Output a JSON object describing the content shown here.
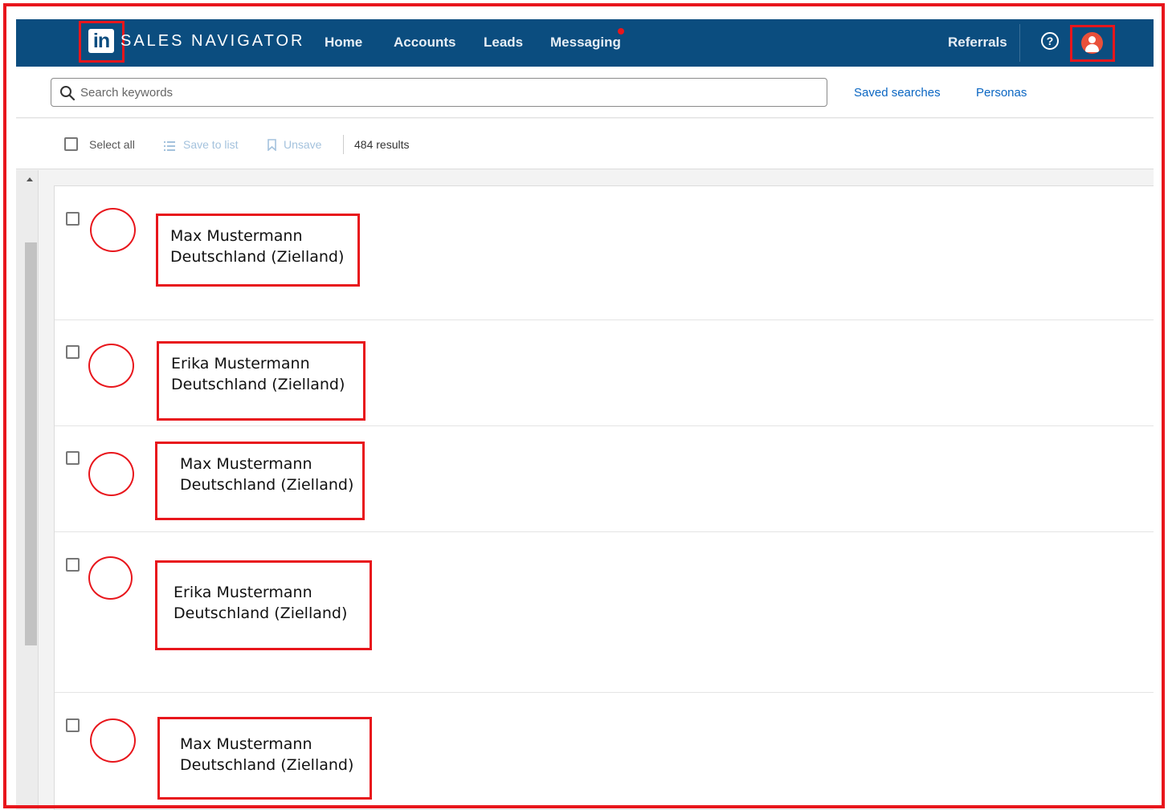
{
  "nav": {
    "logo_text": "in",
    "brand": "SALES NAVIGATOR",
    "links": [
      "Home",
      "Accounts",
      "Leads",
      "Messaging"
    ],
    "referrals": "Referrals",
    "help_symbol": "?"
  },
  "search": {
    "placeholder": "Search keywords",
    "saved_searches": "Saved searches",
    "personas": "Personas"
  },
  "toolbar": {
    "select_all": "Select all",
    "save_to_list": "Save to list",
    "unsave": "Unsave",
    "results_count": "484 results"
  },
  "leads": [
    {
      "name": "Max Mustermann",
      "location": "Deutschland (Zielland)"
    },
    {
      "name": "Erika Mustermann",
      "location": "Deutschland (Zielland)"
    },
    {
      "name": "Max Mustermann",
      "location": "Deutschland (Zielland)"
    },
    {
      "name": "Erika Mustermann",
      "location": "Deutschland (Zielland)"
    },
    {
      "name": "Max Mustermann",
      "location": "Deutschland (Zielland)"
    }
  ],
  "colors": {
    "nav_background": "#0b4d7f",
    "highlight_red": "#e8161c",
    "link_blue": "#0a66c2",
    "avatar_orange": "#e9503a"
  }
}
